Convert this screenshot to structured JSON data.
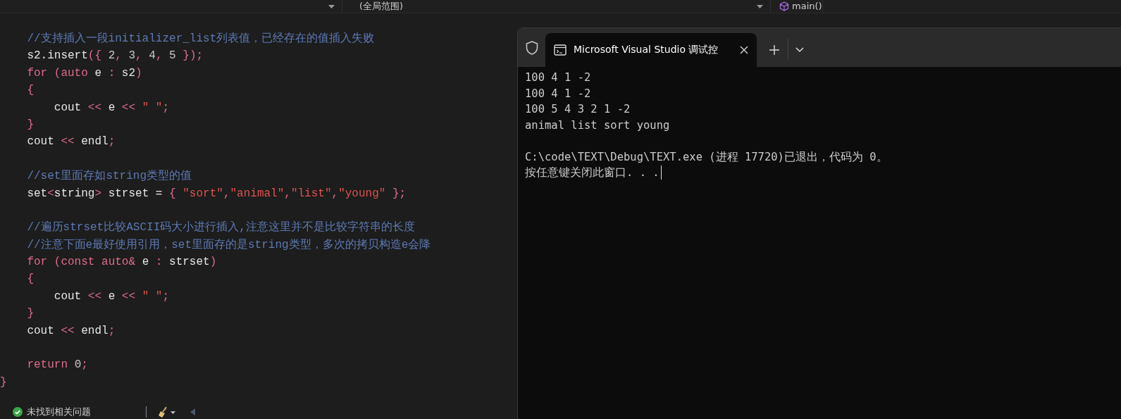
{
  "nav_bar": {
    "scope": "(全局范围)",
    "member": "main()"
  },
  "code_lines": [
    {
      "kind": "code",
      "segments": [
        {
          "kind": "comment",
          "text": "    //支持插入一段initializer_list列表值，已经存在的值插入失败"
        }
      ]
    },
    {
      "kind": "code",
      "segments": [
        {
          "kind": "plain",
          "text": "    s2.insert"
        },
        {
          "kind": "keyword",
          "text": "({ "
        },
        {
          "kind": "number",
          "text": "2"
        },
        {
          "kind": "keyword",
          "text": ", "
        },
        {
          "kind": "number",
          "text": "3"
        },
        {
          "kind": "keyword",
          "text": ", "
        },
        {
          "kind": "number",
          "text": "4"
        },
        {
          "kind": "keyword",
          "text": ", "
        },
        {
          "kind": "number",
          "text": "5"
        },
        {
          "kind": "keyword",
          "text": " });"
        }
      ]
    },
    {
      "kind": "code",
      "segments": [
        {
          "kind": "keyword",
          "text": "    for (auto "
        },
        {
          "kind": "plain",
          "text": "e"
        },
        {
          "kind": "keyword",
          "text": " : "
        },
        {
          "kind": "plain",
          "text": "s2"
        },
        {
          "kind": "keyword",
          "text": ")"
        }
      ]
    },
    {
      "kind": "code",
      "segments": [
        {
          "kind": "keyword",
          "text": "    {"
        }
      ]
    },
    {
      "kind": "code",
      "segments": [
        {
          "kind": "plain",
          "text": "        cout "
        },
        {
          "kind": "keyword",
          "text": "<< "
        },
        {
          "kind": "plain",
          "text": "e "
        },
        {
          "kind": "keyword",
          "text": "<< "
        },
        {
          "kind": "string",
          "text": "\" \""
        },
        {
          "kind": "keyword",
          "text": ";"
        }
      ]
    },
    {
      "kind": "code",
      "segments": [
        {
          "kind": "keyword",
          "text": "    }"
        }
      ]
    },
    {
      "kind": "code",
      "segments": [
        {
          "kind": "plain",
          "text": "    cout "
        },
        {
          "kind": "keyword",
          "text": "<< "
        },
        {
          "kind": "plain",
          "text": "endl"
        },
        {
          "kind": "keyword",
          "text": ";"
        }
      ]
    },
    {
      "kind": "blank"
    },
    {
      "kind": "code",
      "segments": [
        {
          "kind": "comment",
          "text": "    //set里面存如string类型的值"
        }
      ]
    },
    {
      "kind": "code",
      "segments": [
        {
          "kind": "plain",
          "text": "    set"
        },
        {
          "kind": "keyword",
          "text": "<"
        },
        {
          "kind": "plain",
          "text": "string"
        },
        {
          "kind": "keyword",
          "text": "> "
        },
        {
          "kind": "plain",
          "text": "strset = "
        },
        {
          "kind": "keyword",
          "text": "{ "
        },
        {
          "kind": "string",
          "text": "\"sort\""
        },
        {
          "kind": "keyword",
          "text": ","
        },
        {
          "kind": "string",
          "text": "\"animal\""
        },
        {
          "kind": "keyword",
          "text": ","
        },
        {
          "kind": "string",
          "text": "\"list\""
        },
        {
          "kind": "keyword",
          "text": ","
        },
        {
          "kind": "string",
          "text": "\"young\""
        },
        {
          "kind": "keyword",
          "text": " };"
        }
      ]
    },
    {
      "kind": "blank"
    },
    {
      "kind": "code",
      "segments": [
        {
          "kind": "comment",
          "text": "    //遍历strset比较ASCII码大小进行插入,注意这里并不是比较字符串的长度"
        }
      ]
    },
    {
      "kind": "code",
      "segments": [
        {
          "kind": "comment",
          "text": "    //注意下面e最好使用引用，set里面存的是string类型，多次的拷贝构造e会降"
        }
      ]
    },
    {
      "kind": "code",
      "segments": [
        {
          "kind": "keyword",
          "text": "    for (const auto& "
        },
        {
          "kind": "plain",
          "text": "e "
        },
        {
          "kind": "keyword",
          "text": ": "
        },
        {
          "kind": "plain",
          "text": "strset"
        },
        {
          "kind": "keyword",
          "text": ")"
        }
      ]
    },
    {
      "kind": "code",
      "segments": [
        {
          "kind": "keyword",
          "text": "    {"
        }
      ]
    },
    {
      "kind": "code",
      "segments": [
        {
          "kind": "plain",
          "text": "        cout "
        },
        {
          "kind": "keyword",
          "text": "<< "
        },
        {
          "kind": "plain",
          "text": "e "
        },
        {
          "kind": "keyword",
          "text": "<< "
        },
        {
          "kind": "string",
          "text": "\" \""
        },
        {
          "kind": "keyword",
          "text": ";"
        }
      ]
    },
    {
      "kind": "code",
      "segments": [
        {
          "kind": "keyword",
          "text": "    }"
        }
      ]
    },
    {
      "kind": "code",
      "segments": [
        {
          "kind": "plain",
          "text": "    cout "
        },
        {
          "kind": "keyword",
          "text": "<< "
        },
        {
          "kind": "plain",
          "text": "endl"
        },
        {
          "kind": "keyword",
          "text": ";"
        }
      ]
    },
    {
      "kind": "blank"
    },
    {
      "kind": "code",
      "segments": [
        {
          "kind": "keyword",
          "text": "    return "
        },
        {
          "kind": "number",
          "text": "0"
        },
        {
          "kind": "keyword",
          "text": ";"
        }
      ]
    },
    {
      "kind": "code",
      "segments": [
        {
          "kind": "keyword",
          "text": "}"
        }
      ]
    }
  ],
  "status_bar": {
    "issues": "未找到相关问题"
  },
  "terminal": {
    "tabs": [
      {
        "title": "Microsoft Visual Studio 调试控",
        "selected": true
      }
    ],
    "output_blocks": [
      [
        "100 4 1 -2",
        "100 4 1 -2",
        "100 5 4 3 2 1 -2",
        "animal list sort young"
      ],
      [
        "C:\\code\\TEXT\\Debug\\TEXT.exe (进程 17720)已退出，代码为 0。",
        "按任意键关闭此窗口. . ."
      ]
    ]
  }
}
